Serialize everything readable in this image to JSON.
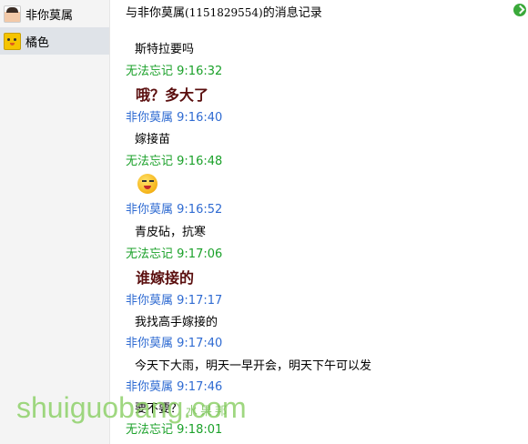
{
  "sidebar": {
    "contacts": [
      {
        "name": "非你莫属"
      },
      {
        "name": "橘色"
      }
    ]
  },
  "header": {
    "prefix": "与非你莫属",
    "qq": "(1151829554)",
    "suffix": "的消息记录"
  },
  "messages": [
    {
      "text": "斯特拉要吗"
    },
    {
      "sender": "无法忘记",
      "time": "9:16:32",
      "text": "哦？多大了"
    },
    {
      "sender": "非你莫属",
      "time": "9:16:40",
      "text": "嫁接苗"
    },
    {
      "sender": "无法忘记",
      "time": "9:16:48",
      "emoji": "grin-emoji"
    },
    {
      "sender": "非你莫属",
      "time": "9:16:52",
      "text": "青皮砧，抗寒"
    },
    {
      "sender": "无法忘记",
      "time": "9:17:06",
      "text": "谁嫁接的"
    },
    {
      "sender": "非你莫属",
      "time": "9:17:17",
      "text": "我找高手嫁接的"
    },
    {
      "sender": "非你莫属",
      "time": "9:17:40",
      "text": "今天下大雨，明天一早开会，明天下午可以发"
    },
    {
      "sender": "非你莫属",
      "time": "9:17:46",
      "text": "要不要？"
    },
    {
      "sender": "无法忘记",
      "time": "9:18:01"
    }
  ],
  "watermark": {
    "text": "shuiguobang.com",
    "cn": "水果邦"
  },
  "colors": {
    "me": "#1ba12a",
    "them": "#2f6bd2",
    "emphasis": "#5a0e0e"
  }
}
